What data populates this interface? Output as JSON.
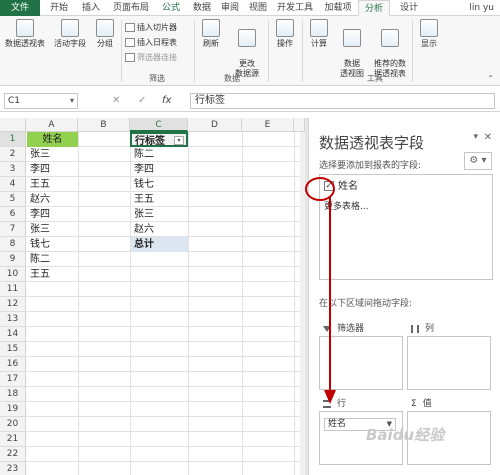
{
  "tabs": [
    "文件",
    "开始",
    "插入",
    "页面布局",
    "公式",
    "数据",
    "审阅",
    "视图",
    "开发工具",
    "加载项",
    "分析",
    "设计"
  ],
  "user": "lin yu",
  "ribbon": {
    "pivot_table": "数据透视表",
    "active_field": "活动字段",
    "group": "分组",
    "insert_slicer": "插入切片器",
    "insert_timeline": "插入日程表",
    "filter_connections": "筛选器连接",
    "filter_group": "筛选",
    "refresh": "刷新",
    "change_source": "更改\n数据源",
    "data_group": "数据",
    "actions": "操作",
    "calculate": "计算",
    "pivot_chart": "数据\n透视图",
    "recommended": "推荐的数\n据透视表",
    "tools_group": "工具",
    "show": "显示"
  },
  "formula_bar": {
    "name_box": "C1",
    "cancel": "✕",
    "enter": "✓",
    "fx": "fx",
    "formula": "行标签"
  },
  "grid": {
    "columns": [
      "A",
      "B",
      "C",
      "D",
      "E"
    ],
    "rows": [
      "1",
      "2",
      "3",
      "4",
      "5",
      "6",
      "7",
      "8",
      "9",
      "10",
      "11",
      "12",
      "13",
      "14",
      "15",
      "16",
      "17",
      "18",
      "19",
      "20",
      "21",
      "22",
      "23"
    ],
    "col_a": [
      "姓名",
      "张三",
      "李四",
      "王五",
      "赵六",
      "李四",
      "张三",
      "钱七",
      "陈二",
      "王五"
    ],
    "col_c": [
      "行标签",
      "陈二",
      "李四",
      "钱七",
      "王五",
      "张三",
      "赵六",
      "总计"
    ]
  },
  "panel": {
    "title": "数据透视表字段",
    "subtitle": "选择要添加到报表的字段:",
    "field_name": "姓名",
    "field_checked": "✓",
    "more_tables": "更多表格...",
    "drag_hint": "在以下区域间拖动字段:",
    "filters": "筛选器",
    "columns": "列",
    "rows": "行",
    "values": "值",
    "row_pill": "姓名"
  },
  "watermark": "Baidu经验",
  "colors": {
    "accent": "#217346",
    "header_fill": "#92d050",
    "arrow": "#c00000"
  }
}
